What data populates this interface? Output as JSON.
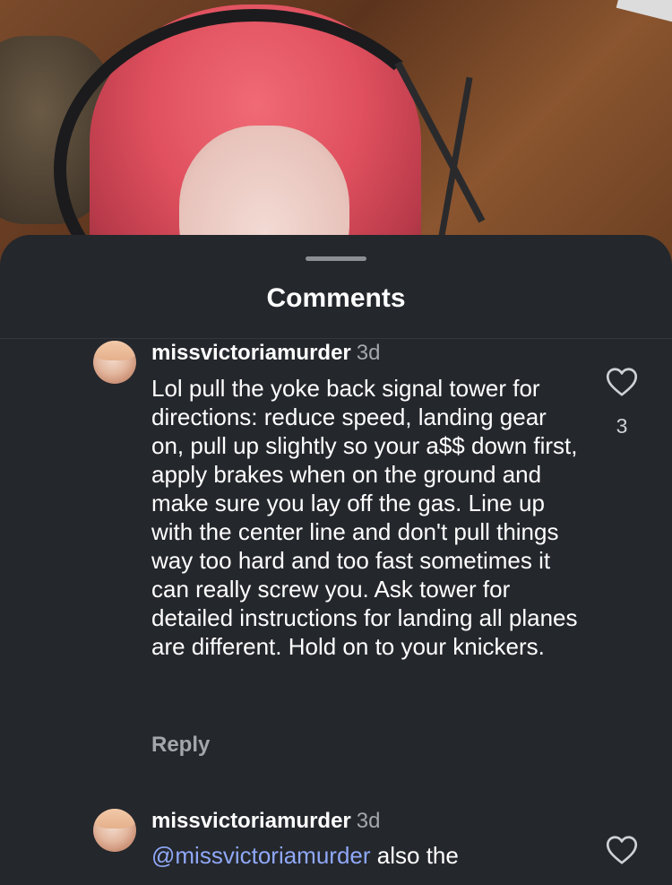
{
  "sheet": {
    "title": "Comments"
  },
  "comments": [
    {
      "username": "missvictoriamurder",
      "time": "3d",
      "text": "Lol pull the yoke back signal tower for directions: reduce speed, landing gear on, pull up slightly so your a$$ down first, apply brakes when on the ground and make sure you lay off the gas. Line up with the center line and don't pull things way too hard and too fast sometimes it can really screw you. Ask tower for detailed instructions  for landing all planes are different. Hold on to your knickers.",
      "like_count": "3",
      "reply_label": "Reply"
    },
    {
      "username": "missvictoriamurder",
      "time": "3d",
      "mention": "@missvictoriamurder",
      "text": " also the"
    }
  ],
  "colors": {
    "sheet_bg": "#24272c",
    "mention": "#8fa8f7",
    "muted_text": "#a3a6ab"
  },
  "icons": [
    "heart-outline-icon"
  ]
}
